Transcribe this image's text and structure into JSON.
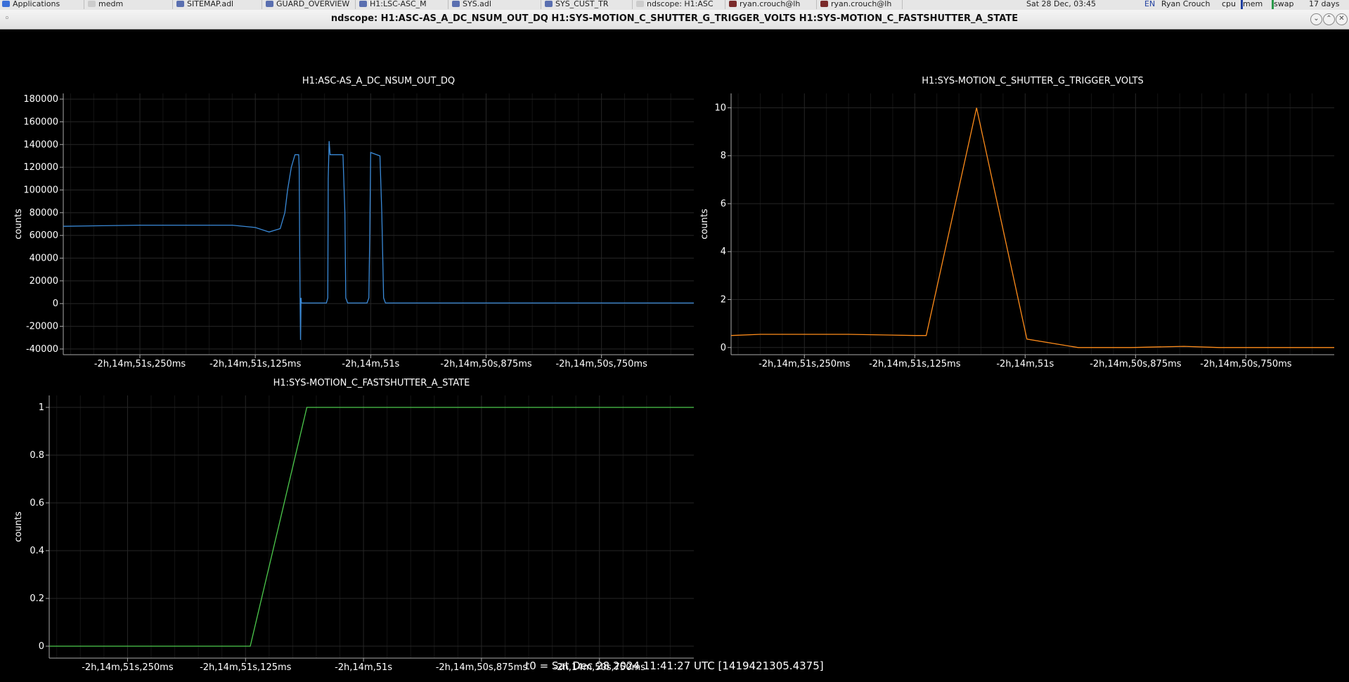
{
  "taskbar": {
    "items": [
      {
        "label": "Applications",
        "color": "#3a6fd8"
      },
      {
        "label": "medm",
        "color": "#cccccc"
      },
      {
        "label": "SITEMAP.adl",
        "color": "#5a6fb0"
      },
      {
        "label": "GUARD_OVERVIEW",
        "color": "#5a6fb0"
      },
      {
        "label": "H1:LSC-ASC_M",
        "color": "#5a6fb0"
      },
      {
        "label": "SYS.adl",
        "color": "#5a6fb0"
      },
      {
        "label": "SYS_CUST_TR",
        "color": "#5a6fb0"
      },
      {
        "label": "ndscope: H1:ASC",
        "color": "#cccccc"
      },
      {
        "label": "ryan.crouch@lh",
        "color": "#7a2a2a"
      },
      {
        "label": "ryan.crouch@lh",
        "color": "#7a2a2a"
      }
    ],
    "clock": "Sat 28 Dec, 03:45",
    "lang": "EN",
    "user": "Ryan Crouch",
    "cpu_label": "cpu",
    "mem_label": "mem",
    "swap_label": "swap",
    "uptime": "17 days"
  },
  "window": {
    "title": "ndscope: H1:ASC-AS_A_DC_NSUM_OUT_DQ H1:SYS-MOTION_C_SHUTTER_G_TRIGGER_VOLTS H1:SYS-MOTION_C_FASTSHUTTER_A_STATE",
    "title_icon": "◦",
    "btn_min": "⌄",
    "btn_max": "⌃",
    "btn_close": "✕"
  },
  "chart_data": [
    {
      "type": "line",
      "title": "H1:ASC-AS_A_DC_NSUM_OUT_DQ",
      "ylabel": "counts",
      "color": "#3a8ad8",
      "ylim": [
        -45000,
        185000
      ],
      "yticks": [
        -40000,
        -20000,
        0,
        20000,
        40000,
        60000,
        80000,
        100000,
        120000,
        140000,
        160000,
        180000
      ],
      "xtick_labels": [
        "-2h,14m,51s,250ms",
        "-2h,14m,51s,125ms",
        "-2h,14m,51s",
        "-2h,14m,50s,875ms",
        "-2h,14m,50s,750ms"
      ],
      "series": [
        {
          "x": [
            -0.333,
            -0.25,
            -0.2,
            -0.15,
            -0.125,
            -0.11,
            -0.098,
            -0.093,
            -0.09,
            -0.086,
            -0.082,
            -0.078,
            -0.0775,
            -0.077,
            -0.0765,
            -0.076,
            -0.0755,
            -0.075,
            -0.074,
            -0.073,
            -0.06,
            -0.05,
            -0.048,
            -0.0465,
            -0.046,
            -0.045,
            -0.044,
            -0.04,
            -0.03,
            -0.028,
            -0.027,
            -0.025,
            -0.02,
            -0.01,
            -0.004,
            -0.002,
            -0.001,
            0.0,
            0.01,
            0.012,
            0.014,
            0.016,
            0.05,
            0.1,
            0.15,
            0.2,
            0.25,
            0.3,
            0.35
          ],
          "y": [
            68000,
            69000,
            69000,
            69000,
            67000,
            63000,
            66000,
            80000,
            100000,
            120000,
            131000,
            131000,
            120000,
            60000,
            2000,
            -32000,
            5000,
            500,
            500,
            500,
            500,
            500,
            500,
            5000,
            110000,
            143000,
            131000,
            131000,
            131000,
            80000,
            5000,
            500,
            500,
            500,
            500,
            5000,
            60000,
            133000,
            130000,
            80000,
            5000,
            500,
            500,
            500,
            500,
            500,
            500,
            500,
            500
          ]
        }
      ]
    },
    {
      "type": "line",
      "title": "H1:SYS-MOTION_C_SHUTTER_G_TRIGGER_VOLTS",
      "ylabel": "counts",
      "color": "#ff8c1a",
      "ylim": [
        -0.3,
        10.6
      ],
      "yticks": [
        0,
        2,
        4,
        6,
        8,
        10
      ],
      "xtick_labels": [
        "-2h,14m,51s,250ms",
        "-2h,14m,51s,125ms",
        "-2h,14m,51s",
        "-2h,14m,50s,875ms",
        "-2h,14m,50s,750ms"
      ],
      "series": [
        {
          "x": [
            -0.333,
            -0.3,
            -0.2,
            -0.125,
            -0.112,
            -0.055,
            0.002,
            0.06,
            0.12,
            0.18,
            0.22,
            0.35
          ],
          "y": [
            0.5,
            0.55,
            0.55,
            0.5,
            0.5,
            10.0,
            0.35,
            0.0,
            0.0,
            0.05,
            0.0,
            0.0
          ]
        }
      ]
    },
    {
      "type": "line",
      "title": "H1:SYS-MOTION_C_FASTSHUTTER_A_STATE",
      "ylabel": "counts",
      "color": "#4cc94c",
      "ylim": [
        -0.05,
        1.05
      ],
      "yticks": [
        0,
        0.2,
        0.4,
        0.6,
        0.8,
        1
      ],
      "xtick_labels": [
        "-2h,14m,51s,250ms",
        "-2h,14m,51s,125ms",
        "-2h,14m,51s",
        "-2h,14m,50s,875ms",
        "-2h,14m,50s,750ms"
      ],
      "series": [
        {
          "x": [
            -0.333,
            -0.12,
            -0.06,
            0.35
          ],
          "y": [
            0,
            0,
            1,
            1
          ]
        }
      ]
    }
  ],
  "footer": {
    "t0": "t0 = Sat Dec 28 2024 11:41:27 UTC [1419421305.4375]"
  }
}
